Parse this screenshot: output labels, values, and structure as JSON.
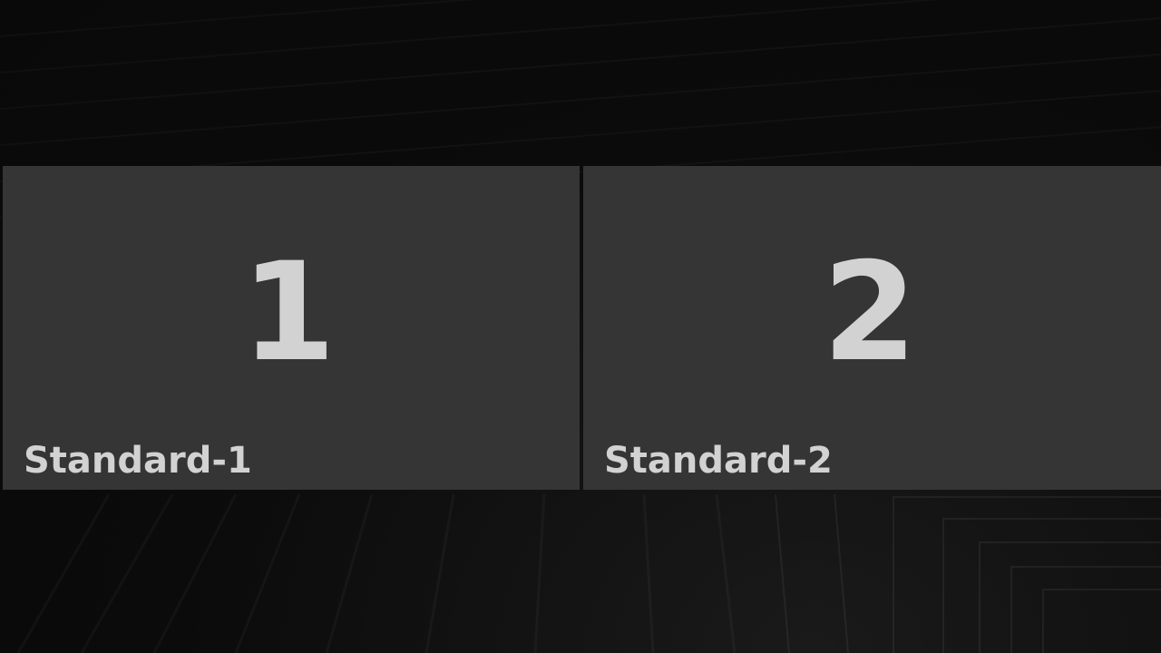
{
  "screen": {
    "colors": {
      "background": "#0c0c0c",
      "tile": "#353535",
      "text": "#d2d2d2"
    }
  },
  "tiles": [
    {
      "number": "1",
      "label": "Standard-1"
    },
    {
      "number": "2",
      "label": "Standard-2"
    }
  ]
}
